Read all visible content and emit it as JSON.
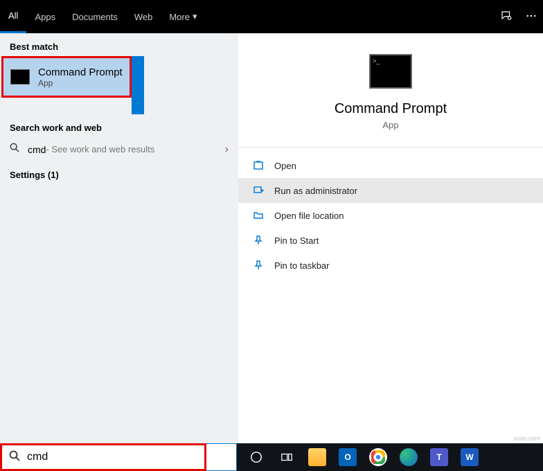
{
  "tabs": {
    "all": "All",
    "apps": "Apps",
    "documents": "Documents",
    "web": "Web",
    "more": "More"
  },
  "left": {
    "best_match_label": "Best match",
    "best_match": {
      "title": "Command Prompt",
      "sub": "App"
    },
    "search_label": "Search work and web",
    "search_query": "cmd",
    "search_hint": " - See work and web results",
    "settings_label": "Settings (1)"
  },
  "preview": {
    "title": "Command Prompt",
    "sub": "App",
    "actions": {
      "open": "Open",
      "run_admin": "Run as administrator",
      "open_location": "Open file location",
      "pin_start": "Pin to Start",
      "pin_taskbar": "Pin to taskbar"
    }
  },
  "taskbar": {
    "search_value": "cmd"
  }
}
